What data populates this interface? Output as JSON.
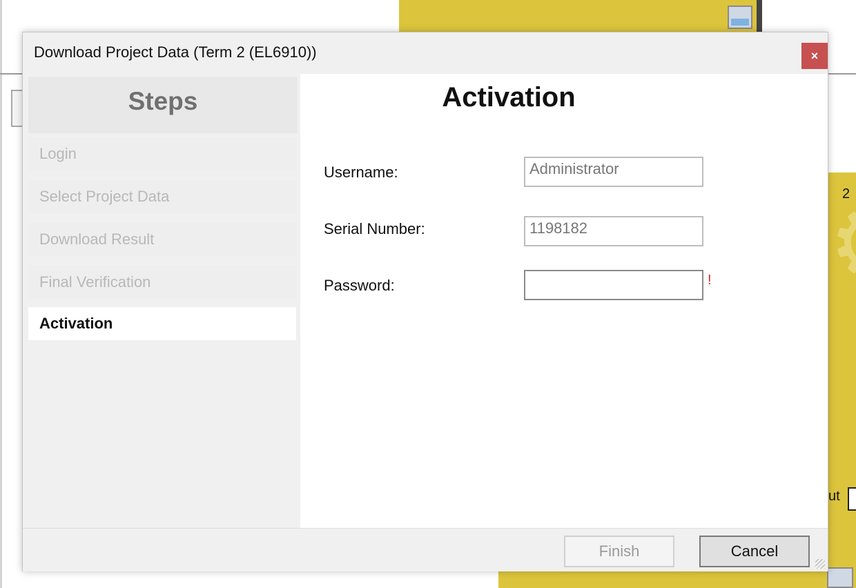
{
  "background": {
    "right_number": "2",
    "right_fragment": "ut"
  },
  "dialog": {
    "title": "Download Project Data (Term 2 (EL6910))",
    "close_label": "×"
  },
  "steps": {
    "header": "Steps",
    "items": [
      {
        "label": "Login",
        "state": "done"
      },
      {
        "label": "Select Project Data",
        "state": "done"
      },
      {
        "label": "Download Result",
        "state": "done"
      },
      {
        "label": "Final Verification",
        "state": "done"
      },
      {
        "label": "Activation",
        "state": "active"
      }
    ]
  },
  "activation": {
    "title": "Activation",
    "username_label": "Username:",
    "username_value": "Administrator",
    "serial_label": "Serial Number:",
    "serial_value": "1198182",
    "password_label": "Password:",
    "password_value": "",
    "required_mark": "!"
  },
  "footer": {
    "finish_label": "Finish",
    "cancel_label": "Cancel"
  },
  "colors": {
    "close_button": "#c75050",
    "background_accent": "#dcc53c",
    "required_mark": "#e02020"
  }
}
